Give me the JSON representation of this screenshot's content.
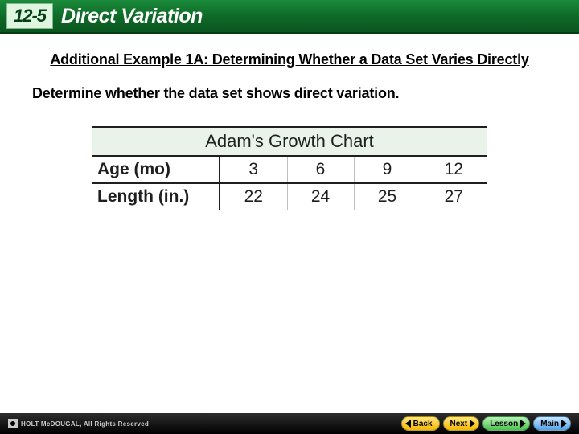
{
  "header": {
    "section": "12-5",
    "title": "Direct Variation"
  },
  "example": {
    "heading": "Additional Example 1A: Determining Whether a Data Set Varies Directly",
    "instruction": "Determine whether the data set shows direct variation."
  },
  "chart_data": {
    "type": "table",
    "title": "Adam's Growth Chart",
    "row1_label": "Age (mo)",
    "row2_label": "Length (in.)",
    "categories": [
      "3",
      "6",
      "9",
      "12"
    ],
    "values": [
      "22",
      "24",
      "25",
      "27"
    ]
  },
  "footer": {
    "copyright": "HOLT McDOUGAL, All Rights Reserved",
    "nav": {
      "back": "Back",
      "next": "Next",
      "lesson": "Lesson",
      "main": "Main"
    }
  }
}
